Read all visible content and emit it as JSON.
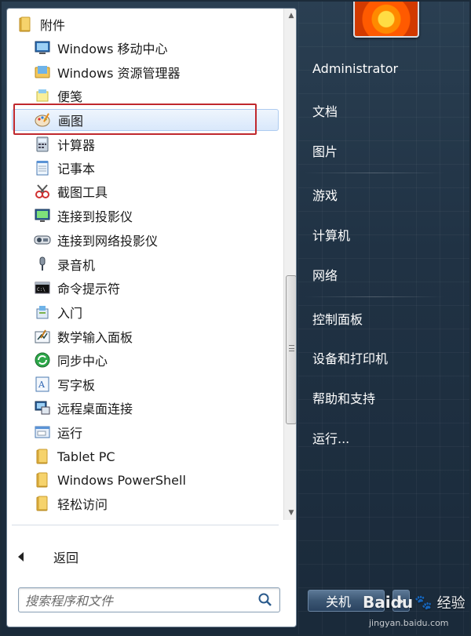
{
  "programs": {
    "folder_label": "附件",
    "items": [
      {
        "label": "Windows 移动中心",
        "icon": "mobility-center-icon"
      },
      {
        "label": "Windows 资源管理器",
        "icon": "explorer-icon"
      },
      {
        "label": "便笺",
        "icon": "sticky-notes-icon"
      },
      {
        "label": "画图",
        "icon": "paint-icon",
        "highlighted": true
      },
      {
        "label": "计算器",
        "icon": "calculator-icon"
      },
      {
        "label": "记事本",
        "icon": "notepad-icon"
      },
      {
        "label": "截图工具",
        "icon": "snipping-tool-icon"
      },
      {
        "label": "连接到投影仪",
        "icon": "projector-icon"
      },
      {
        "label": "连接到网络投影仪",
        "icon": "network-projector-icon"
      },
      {
        "label": "录音机",
        "icon": "microphone-icon"
      },
      {
        "label": "命令提示符",
        "icon": "command-prompt-icon"
      },
      {
        "label": "入门",
        "icon": "getting-started-icon"
      },
      {
        "label": "数学输入面板",
        "icon": "math-input-icon"
      },
      {
        "label": "同步中心",
        "icon": "sync-center-icon"
      },
      {
        "label": "写字板",
        "icon": "wordpad-icon"
      },
      {
        "label": "远程桌面连接",
        "icon": "remote-desktop-icon"
      },
      {
        "label": "运行",
        "icon": "run-icon"
      }
    ],
    "subfolders": [
      {
        "label": "Tablet PC",
        "icon": "folder-icon"
      },
      {
        "label": "Windows PowerShell",
        "icon": "folder-icon"
      },
      {
        "label": "轻松访问",
        "icon": "folder-icon"
      }
    ]
  },
  "back_label": "返回",
  "search": {
    "placeholder": "搜索程序和文件"
  },
  "right_menu": {
    "user": "Administrator",
    "items": [
      "文档",
      "图片",
      "游戏",
      "计算机",
      "网络",
      "控制面板",
      "设备和打印机",
      "帮助和支持",
      "运行..."
    ]
  },
  "shutdown_label": "关机",
  "watermark": {
    "brand": "Baidu",
    "suffix": "经验",
    "url": "jingyan.baidu.com"
  },
  "colors": {
    "highlight_border": "#c0282d",
    "selected_bg": "#d9e8fb"
  }
}
